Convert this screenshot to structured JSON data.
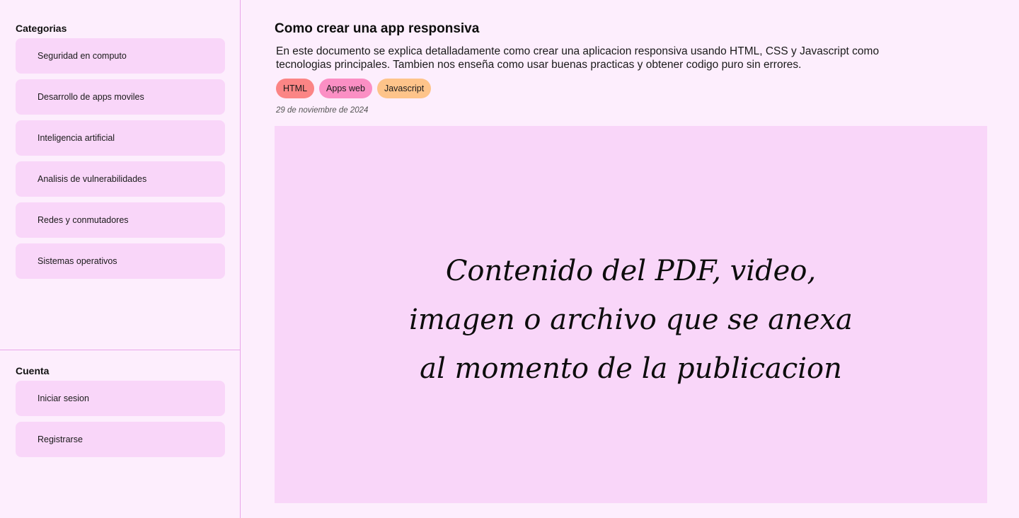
{
  "sidebar": {
    "categories_title": "Categorias",
    "categories": [
      {
        "label": "Seguridad en computo"
      },
      {
        "label": "Desarrollo de apps moviles"
      },
      {
        "label": "Inteligencia artificial"
      },
      {
        "label": "Analisis de vulnerabilidades"
      },
      {
        "label": "Redes y conmutadores"
      },
      {
        "label": "Sistemas operativos"
      }
    ],
    "account_title": "Cuenta",
    "account_items": [
      {
        "label": "Iniciar sesion"
      },
      {
        "label": "Registrarse"
      }
    ]
  },
  "main": {
    "title": "Como crear una app responsiva",
    "description": "En este documento se explica detalladamente como crear una aplicacion responsiva usando HTML, CSS y Javascript como tecnologias principales. Tambien nos enseña como usar buenas practicas y obtener codigo puro sin errores.",
    "tags": [
      {
        "label": "HTML",
        "color": "#fb8585"
      },
      {
        "label": "Apps web",
        "color": "#fb8fc4"
      },
      {
        "label": "Javascript",
        "color": "#fec48a"
      }
    ],
    "date": "29 de noviembre de 2024",
    "content_lines": [
      "Contenido del PDF, video,",
      "imagen o archivo que se anexa",
      "al momento de la publicacion"
    ]
  },
  "colors": {
    "background": "#fdeefd",
    "panel": "#f9d6f9",
    "divider": "#e9a6ea"
  }
}
